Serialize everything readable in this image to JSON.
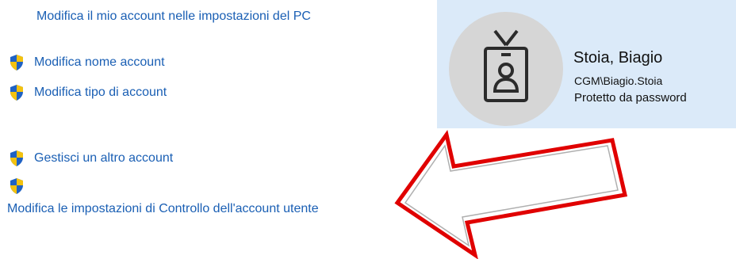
{
  "links": {
    "pc_settings": "Modifica il mio account nelle impostazioni del PC",
    "change_name": "Modifica nome account",
    "change_type": "Modifica tipo di account",
    "manage_other": "Gestisci un altro account",
    "uac_settings": "Modifica le impostazioni di Controllo dell'account utente"
  },
  "user": {
    "name": "Stoia, Biagio",
    "domain_account": "CGM\\Biagio.Stoia",
    "status": "Protetto da password",
    "avatar_icon": "id-badge-icon"
  },
  "colors": {
    "link": "#1a5fb4",
    "panel": "#dbeaf9",
    "avatar_bg": "#d6d6d6",
    "arrow_outline": "#e00000",
    "shield_blue": "#1f62c4",
    "shield_yellow": "#f3c20f"
  },
  "icons": {
    "uac_shield": "uac-shield-icon",
    "annotation_arrow": "red-arrow-annotation"
  }
}
